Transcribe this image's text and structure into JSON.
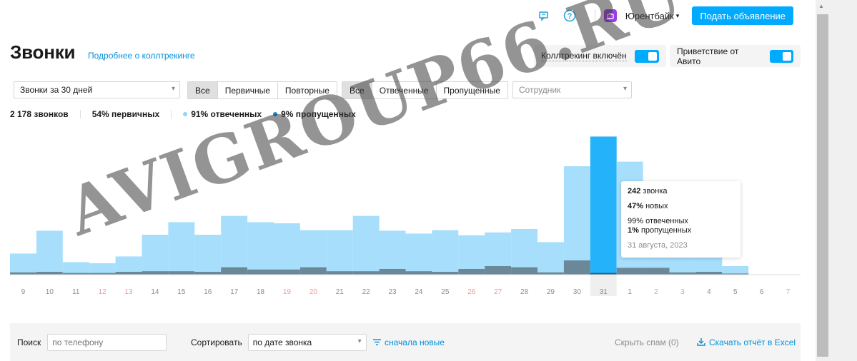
{
  "topbar": {
    "user_name": "Юрентбайк",
    "post_button": "Подать объявление",
    "icons": [
      "chat-icon",
      "help-icon",
      "shop-avatar-icon"
    ],
    "accent_color": "#00aaff"
  },
  "page": {
    "title": "Звонки",
    "title_link": "Подробнее о коллтрекинге"
  },
  "toggles": {
    "calltracking_label": "Коллтрекинг включён",
    "greeting_label": "Приветствие от Авито",
    "calltracking_on": true,
    "greeting_on": true
  },
  "filters": {
    "period": "Звонки за 30 дней",
    "type_tabs": [
      "Все",
      "Первичные",
      "Повторные"
    ],
    "status_tabs": [
      "Все",
      "Отвеченные",
      "Пропущенные"
    ],
    "employee_placeholder": "Сотрудник"
  },
  "stats": {
    "total": "2 178 звонков",
    "primary": "54% первичных",
    "answered": "91% отвеченных",
    "missed": "9% пропущенных",
    "answered_color": "#8fd5fc",
    "missed_color": "#0a8ed6"
  },
  "chart_data": {
    "type": "bar",
    "categories": [
      "9",
      "10",
      "11",
      "12",
      "13",
      "14",
      "15",
      "16",
      "17",
      "18",
      "19",
      "20",
      "21",
      "22",
      "23",
      "24",
      "25",
      "26",
      "27",
      "28",
      "29",
      "30",
      "31",
      "1",
      "2",
      "3",
      "4",
      "5",
      "6",
      "7"
    ],
    "weekend_indices": [
      3,
      4,
      10,
      11,
      17,
      18,
      24,
      25,
      29
    ],
    "highlight_index": 22,
    "series": [
      {
        "name": "Отвеченные",
        "values": [
          37,
          77,
          22,
          20,
          32,
          70,
          92,
          70,
          103,
          92,
          90,
          78,
          78,
          103,
          77,
          72,
          78,
          69,
          74,
          80,
          57,
          190,
          242,
          198,
          45,
          45,
          52,
          15,
          0,
          0
        ],
        "color": "#a6defc"
      },
      {
        "name": "Пропущенные",
        "values": [
          4,
          5,
          3,
          3,
          5,
          6,
          6,
          5,
          13,
          9,
          9,
          13,
          6,
          6,
          10,
          6,
          5,
          10,
          15,
          13,
          4,
          25,
          3,
          12,
          12,
          4,
          5,
          2,
          0,
          0
        ],
        "color": "#6a8897"
      }
    ],
    "ylim": [
      0,
      260
    ]
  },
  "tooltip": {
    "total_num": "242",
    "total_word": "звонка",
    "new_num": "47%",
    "new_word": "новых",
    "answered": "99% отвеченных",
    "missed_num": "1%",
    "missed_word": "пропущенных",
    "date": "31 августа, 2023"
  },
  "bottom": {
    "search_label": "Поиск",
    "search_placeholder": "по телефону",
    "sort_label": "Сортировать",
    "sort_value": "по дате звонка",
    "order": "сначала новые",
    "spam": "Скрыть спам (0)",
    "excel": "Скачать отчёт в Excel"
  },
  "watermark": "AVIGROUP66.RU"
}
